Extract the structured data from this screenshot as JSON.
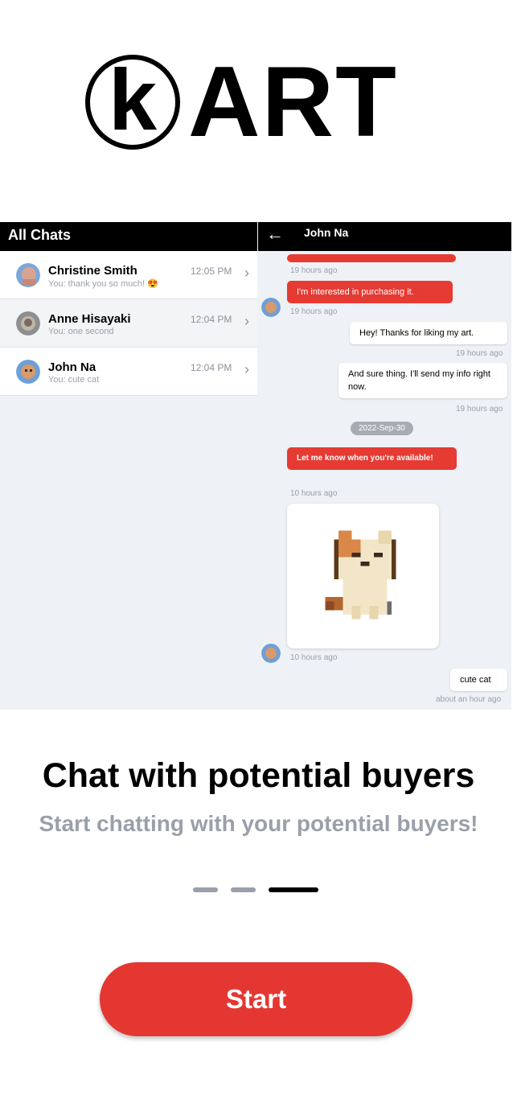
{
  "brand": {
    "logo_letter": "k",
    "logo_word": "ART"
  },
  "colors": {
    "accent": "#e53731",
    "dark": "#000000",
    "muted": "#9aa0aa",
    "panel": "#eef1f6"
  },
  "chat_list": {
    "header": "All Chats",
    "items": [
      {
        "name": "Christine Smith",
        "preview": "You: thank you so much! 😍",
        "time": "12:05 PM",
        "avatar_icon": "avatar-christine"
      },
      {
        "name": "Anne Hisayaki",
        "preview": "You: one second",
        "time": "12:04 PM",
        "avatar_icon": "avatar-anne"
      },
      {
        "name": "John Na",
        "preview": "You: cute cat",
        "time": "12:04 PM",
        "avatar_icon": "avatar-john"
      }
    ]
  },
  "conversation": {
    "title": "John Na",
    "back_icon": "arrow-left-icon",
    "messages": [
      {
        "meta_top": "19 hours ago"
      },
      {
        "text": "I'm interested in purchasing it.",
        "meta": "19 hours ago"
      },
      {
        "text": "Hey! Thanks for liking my art.",
        "meta": "19 hours ago"
      },
      {
        "text": "And sure thing. I'll send my info right now.",
        "meta": "19 hours ago"
      },
      {
        "text": "Let me know when you're available!",
        "meta": "10 hours ago"
      },
      {
        "image": "pixel-cat",
        "meta": "10 hours ago"
      },
      {
        "text": "cute cat",
        "meta": "about an hour ago"
      }
    ],
    "date_divider": "2022-Sep-30"
  },
  "onboarding": {
    "headline": "Chat with potential buyers",
    "subline": "Start chatting with your potential buyers!",
    "page_index": 3,
    "page_count": 3
  },
  "start_button": "Start"
}
